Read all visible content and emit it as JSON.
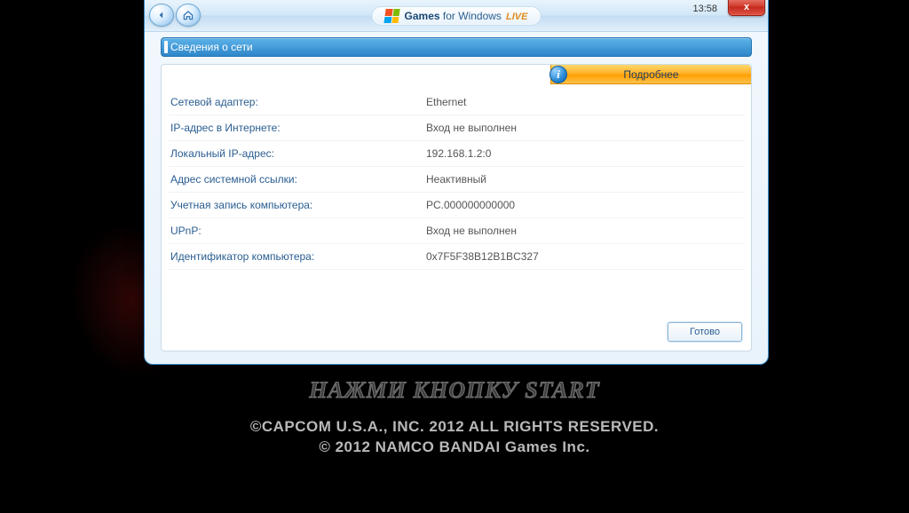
{
  "header": {
    "brand_prefix": "Games",
    "brand_mid": " for Windows",
    "brand_live": " LIVE",
    "clock": "13:58",
    "close_label": "x"
  },
  "section": {
    "title": "Сведения о сети"
  },
  "details_bar": {
    "label": "Подробнее",
    "info_glyph": "i"
  },
  "rows": [
    {
      "label": "Сетевой адаптер:",
      "value": "Ethernet"
    },
    {
      "label": "IP-адрес в Интернете:",
      "value": "Вход не выполнен"
    },
    {
      "label": "Локальный IP-адрес:",
      "value": "192.168.1.2:0"
    },
    {
      "label": "Адрес системной ссылки:",
      "value": "Неактивный"
    },
    {
      "label": "Учетная запись компьютера:",
      "value": "PC.000000000000"
    },
    {
      "label": "UPnP:",
      "value": "Вход не выполнен"
    },
    {
      "label": "Идентификатор компьютера:",
      "value": "0x7F5F38B12B1BC327"
    }
  ],
  "buttons": {
    "done": "Готово"
  },
  "background": {
    "press_start": "НАЖМИ КНОПКУ START",
    "copyright1": "©CAPCOM U.S.A., INC. 2012 ALL RIGHTS RESERVED.",
    "copyright2": "© 2012 NAMCO BANDAI Games Inc."
  }
}
